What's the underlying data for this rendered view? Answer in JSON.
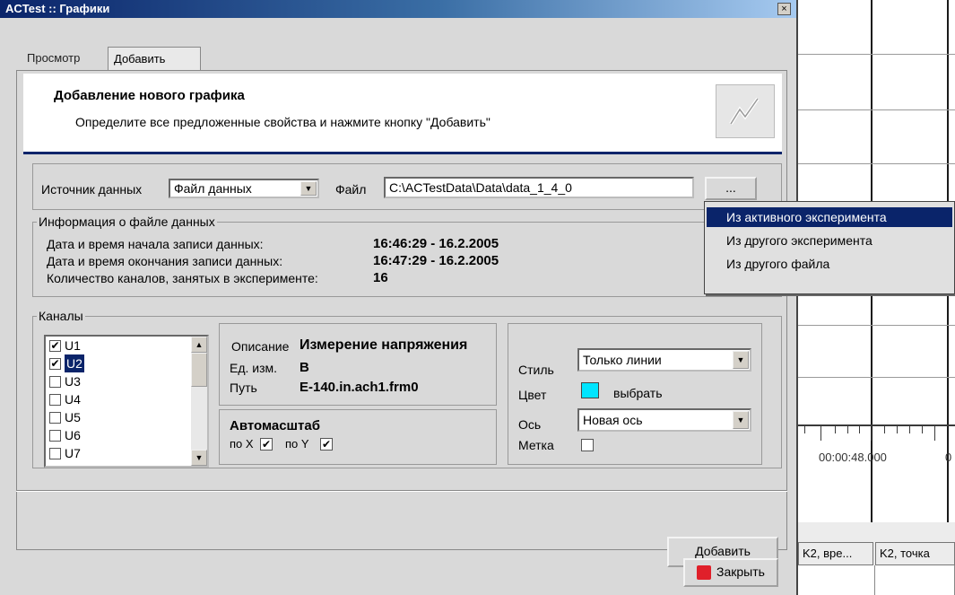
{
  "window": {
    "title": "ACTest :: Графики",
    "close_glyph": "×"
  },
  "tabs": [
    {
      "label": "Просмотр"
    },
    {
      "label": "Добавить"
    }
  ],
  "header": {
    "title": "Добавление нового графика",
    "subtitle": "Определите все предложенные свойства и нажмите кнопку \"Добавить\""
  },
  "source": {
    "label": "Источник данных",
    "value": "Файл данных",
    "file_label": "Файл",
    "file_value": "C:\\ACTestData\\Data\\data_1_4_0",
    "browse_label": "..."
  },
  "file_info": {
    "group_label": "Информация о файле данных",
    "start_label": "Дата и время начала записи данных:",
    "start_value": "16:46:29 - 16.2.2005",
    "end_label": "Дата и время окончания записи данных:",
    "end_value": "16:47:29 - 16.2.2005",
    "channels_label": "Количество каналов, занятых в эксперименте:",
    "channels_value": "16"
  },
  "channels": {
    "group_label": "Каналы",
    "items": [
      {
        "label": "U1",
        "checked": true
      },
      {
        "label": "U2",
        "checked": true,
        "selected": true
      },
      {
        "label": "U3",
        "checked": false
      },
      {
        "label": "U4",
        "checked": false
      },
      {
        "label": "U5",
        "checked": false
      },
      {
        "label": "U6",
        "checked": false
      },
      {
        "label": "U7",
        "checked": false
      }
    ],
    "check_glyph": "✔"
  },
  "description": {
    "desc_label": "Описание",
    "desc_value": "Измерение напряжения",
    "unit_label": "Ед. изм.",
    "unit_value": "В",
    "path_label": "Путь",
    "path_value": "E-140.in.ach1.frm0"
  },
  "autoscale": {
    "title": "Автомасштаб",
    "x_label": "по X",
    "y_label": "по Y"
  },
  "style": {
    "style_label": "Стиль",
    "style_value": "Только линии",
    "color_label": "Цвет",
    "color_hex": "#00e5ff",
    "color_action": "выбрать",
    "axis_label": "Ось",
    "axis_value": "Новая ось",
    "mark_label": "Метка"
  },
  "actions": {
    "add_label": "Добавить",
    "close_label": "Закрыть"
  },
  "popup_menu": {
    "items": [
      {
        "label": "Из активного эксперимента",
        "active": true
      },
      {
        "label": "Из другого эксперимента",
        "active": false
      },
      {
        "label": "Из другого файла",
        "active": false
      }
    ]
  },
  "background": {
    "time_label": "00:00:48.000",
    "time_label_cut": "0",
    "col1": "K2, вре...",
    "col2": "K2, точка"
  }
}
